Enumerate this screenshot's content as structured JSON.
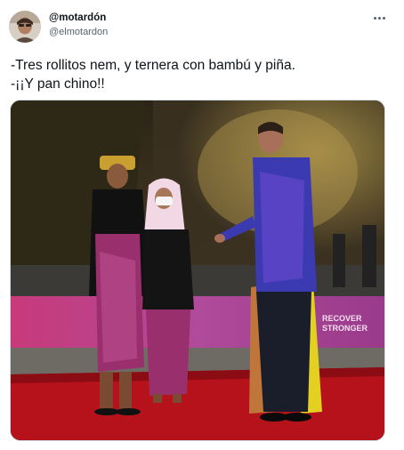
{
  "author": {
    "display_name": "@motardón",
    "handle": "@elmotardon"
  },
  "tweet": {
    "lines": [
      "-Tres rollitos nem, y ternera con bambú y piña.",
      "-¡¡Y pan chino!!"
    ]
  },
  "media": {
    "banner_text_line1": "RECOVER",
    "banner_text_line2": "STRONGER"
  },
  "icons": {
    "more": "more-options-icon"
  }
}
